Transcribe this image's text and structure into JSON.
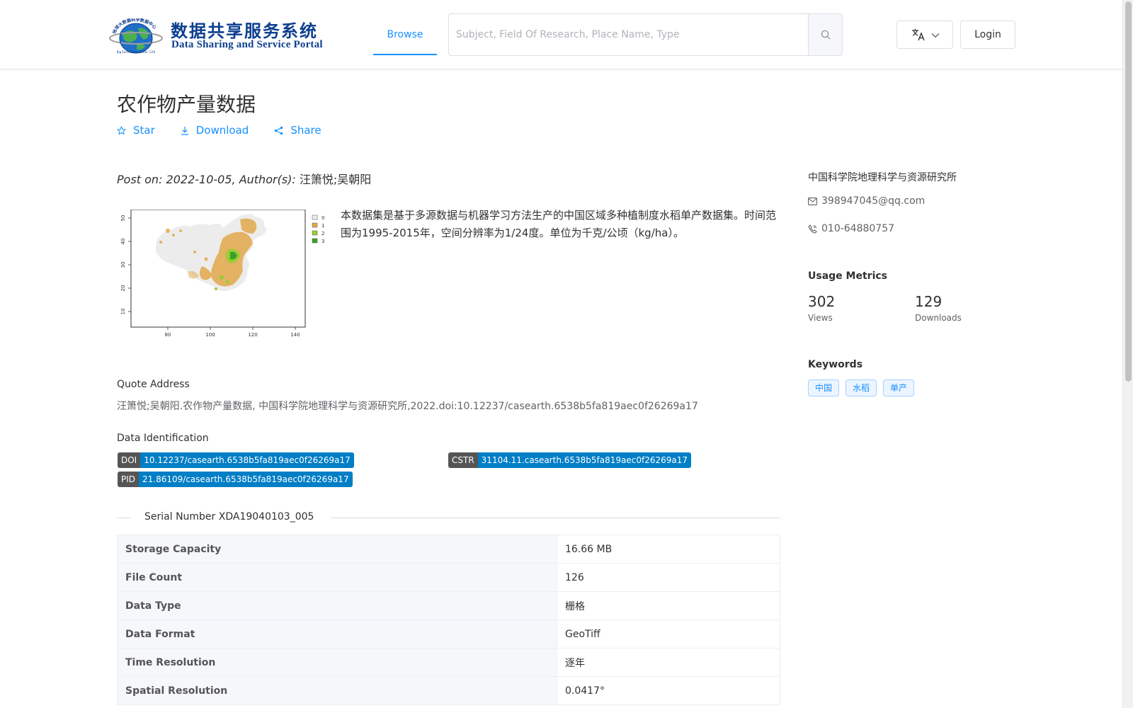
{
  "header": {
    "logo_cn": "数据共享服务系统",
    "logo_en": "Data Sharing and Service Portal",
    "logo_ring_text": "地球大数据科学数据中心",
    "logo_small_text": "Big Earth Data Center, CAS",
    "nav_browse": "Browse",
    "search_placeholder": "Subject, Field Of Research, Place Name, Type",
    "login": "Login"
  },
  "dataset": {
    "title": "农作物产量数据",
    "actions": {
      "star": "Star",
      "download": "Download",
      "share": "Share"
    },
    "post_prefix": "Post on: 2022-10-05, Author(s): ",
    "authors": "汪箫悦;吴朝阳",
    "description": "本数据集是基于多源数据与机器学习方法生产的中国区域多种植制度水稻单产数据集。时间范围为1995-2015年，空间分辨率为1/24度。单位为千克/公顷（kg/ha）。",
    "map": {
      "y_ticks": [
        "50",
        "40",
        "30",
        "20",
        "10"
      ],
      "x_ticks": [
        "80",
        "100",
        "120",
        "140"
      ],
      "legend": [
        "0",
        "1",
        "2",
        "3"
      ],
      "legend_colors": [
        "#eeeeee",
        "#e2a84b",
        "#9acd32",
        "#3aa02c"
      ]
    },
    "quote_label": "Quote Address",
    "quote_text": "汪箫悦;吴朝阳.农作物产量数据, 中国科学院地理科学与资源研究所,2022.doi:10.12237/casearth.6538b5fa819aec0f26269a17",
    "identification_label": "Data Identification",
    "identifiers": {
      "doi_key": "DOI",
      "doi_val": "10.12237/casearth.6538b5fa819aec0f26269a17",
      "cstr_key": "CSTR",
      "cstr_val": "31104.11.casearth.6538b5fa819aec0f26269a17",
      "pid_key": "PID",
      "pid_val": "21.86109/casearth.6538b5fa819aec0f26269a17"
    },
    "serial_number": "Serial Number XDA19040103_005",
    "table": [
      {
        "key": "Storage Capacity",
        "value": "16.66 MB"
      },
      {
        "key": "File Count",
        "value": "126"
      },
      {
        "key": "Data Type",
        "value": "栅格"
      },
      {
        "key": "Data Format",
        "value": "GeoTiff"
      },
      {
        "key": "Time Resolution",
        "value": "逐年"
      },
      {
        "key": "Spatial Resolution",
        "value": "0.0417°"
      }
    ]
  },
  "sidebar": {
    "organization": "中国科学院地理科学与资源研究所",
    "email": "398947045@qq.com",
    "phone": "010-64880757",
    "usage_title": "Usage Metrics",
    "views_count": "302",
    "views_label": "Views",
    "downloads_count": "129",
    "downloads_label": "Downloads",
    "keywords_title": "Keywords",
    "keywords": [
      "中国",
      "水稻",
      "单产"
    ]
  },
  "colors": {
    "accent": "#1890ff",
    "badge_key": "#555555",
    "badge_val": "#007ec6"
  }
}
